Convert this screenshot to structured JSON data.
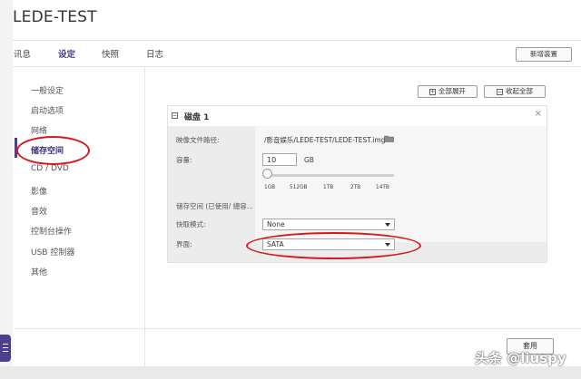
{
  "app": {
    "title": "LEDE-TEST"
  },
  "main_tabs": [
    {
      "label": "讯息"
    },
    {
      "label": "设定"
    },
    {
      "label": "快照"
    },
    {
      "label": "日志"
    }
  ],
  "toolbar": {
    "new_device_label": "新增装置"
  },
  "sidebar": {
    "items": [
      {
        "label": "一般设定"
      },
      {
        "label": "启动选项"
      },
      {
        "label": "网络"
      },
      {
        "label": "储存空间"
      },
      {
        "label": "CD / DVD"
      },
      {
        "label": "影像"
      },
      {
        "label": "音效"
      },
      {
        "label": "控制台操作"
      },
      {
        "label": "USB 控制器"
      },
      {
        "label": "其他"
      }
    ],
    "active": "储存空间"
  },
  "actions": {
    "expand_all": "全部展开",
    "collapse_all": "收起全部",
    "expand_sym": "+",
    "collapse_sym": "−"
  },
  "disk": {
    "title": "磁盘 1",
    "toggle_sym": "−",
    "close_sym": "×",
    "image_path_label": "映像文件路径:",
    "image_path": "/影音娱乐/LEDE-TEST/LEDE-TEST.img",
    "capacity_label": "容量:",
    "capacity_value": "10",
    "capacity_unit": "GB",
    "slider_ticks": [
      "1GB",
      "512GB",
      "1TB",
      "2TB",
      "14TB"
    ],
    "storage_label": "储存空间 (已使用/ 總容...",
    "cache_mode_label": "快取模式:",
    "cache_mode_value": "None",
    "interface_label": "界面:",
    "interface_value": "SATA"
  },
  "footer": {
    "apply_label": "套用"
  },
  "watermark": {
    "text": "头条 @liuspy"
  },
  "colors": {
    "accent": "#4c3f8f",
    "highlight": "#d6191c"
  }
}
